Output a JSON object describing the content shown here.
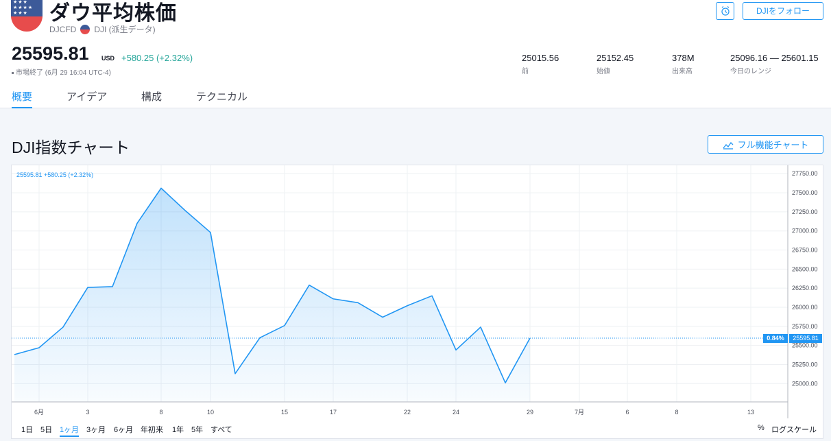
{
  "header": {
    "title": "ダウ平均株価",
    "symbol": "DJCFD",
    "source": "DJI (派生データ)",
    "follow_label": "DJIをフォロー",
    "price": "25595.81",
    "currency": "USD",
    "change": "+580.25 (+2.32%)",
    "status": "市場終了 (6月 29 16:04 UTC-4)",
    "stats": [
      {
        "value": "25015.56",
        "label": "前"
      },
      {
        "value": "25152.45",
        "label": "始値"
      },
      {
        "value": "378M",
        "label": "出来高"
      },
      {
        "value": "25096.16 — 25601.15",
        "label": "今日のレンジ"
      }
    ]
  },
  "tabs": [
    {
      "label": "概要",
      "active": true
    },
    {
      "label": "アイデア",
      "active": false
    },
    {
      "label": "構成",
      "active": false
    },
    {
      "label": "テクニカル",
      "active": false
    }
  ],
  "section": {
    "title": "DJI指数チャート",
    "full_chart_label": "フル機能チャート"
  },
  "chart_legend": "25595.81 +580.25 (+2.32%)",
  "last_badge": {
    "pct": "0.84%",
    "price": "25595.81"
  },
  "ranges": [
    {
      "label": "1日",
      "active": false
    },
    {
      "label": "5日",
      "active": false
    },
    {
      "label": "1ヶ月",
      "active": true
    },
    {
      "label": "3ヶ月",
      "active": false
    },
    {
      "label": "6ヶ月",
      "active": false
    },
    {
      "label": "年初来",
      "active": false
    },
    {
      "label": "1年",
      "active": false
    },
    {
      "label": "5年",
      "active": false
    },
    {
      "label": "すべて",
      "active": false
    }
  ],
  "percent_label": "%",
  "log_scale_label": "ログスケール",
  "colors": {
    "accent": "#2196f3",
    "positive": "#26a69a"
  },
  "chart_data": {
    "type": "area",
    "x": [
      "5月30",
      "5月31",
      "6月1",
      "6月3",
      "6月4",
      "6月5",
      "6月6",
      "6月7",
      "6月10",
      "6月11",
      "6月12",
      "6月13",
      "6月14",
      "6月17",
      "6月18",
      "6月19",
      "6月20",
      "6月21",
      "6月24",
      "6月25",
      "6月26",
      "6月27",
      "6月28",
      "6月29"
    ],
    "values": [
      25380,
      25470,
      25740,
      26260,
      26270,
      27100,
      27560,
      27260,
      26980,
      25130,
      25600,
      25760,
      26290,
      26110,
      26060,
      25870,
      26020,
      26150,
      25440,
      25740,
      25010,
      25595.81
    ],
    "x_ticks": [
      "6月",
      "3",
      "8",
      "10",
      "15",
      "17",
      "22",
      "24",
      "29",
      "7月",
      "6",
      "8",
      "13"
    ],
    "y_ticks": [
      25000,
      25250,
      25500,
      25750,
      26000,
      26250,
      26500,
      26750,
      27000,
      27250,
      27500,
      27750
    ],
    "y_tick_labels": [
      "25000.00",
      "25250.00",
      "25500.00",
      "25750.00",
      "26000.00",
      "26250.00",
      "26500.00",
      "26750.00",
      "27000.00",
      "27250.00",
      "27500.00",
      "27750.00"
    ],
    "ylim": [
      24760,
      27860
    ],
    "last_value": 25595.81,
    "grid": true
  }
}
